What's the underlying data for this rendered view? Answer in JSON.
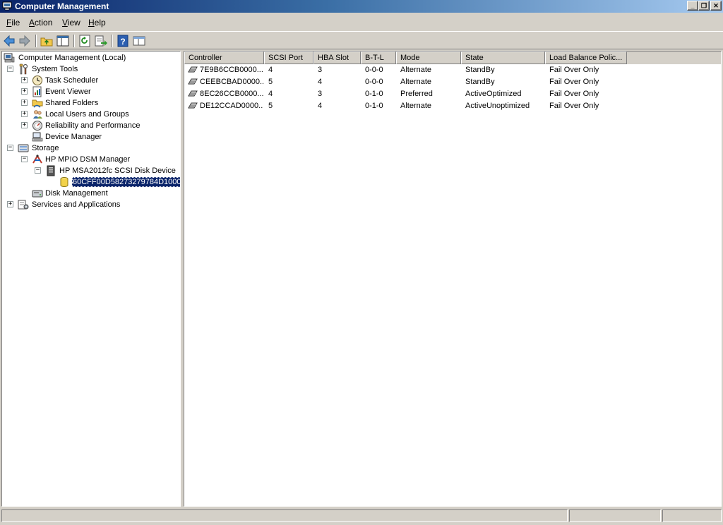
{
  "window": {
    "title": "Computer Management",
    "minimize": "_",
    "maximize": "❐",
    "close": "✕"
  },
  "menu": [
    "File",
    "Action",
    "View",
    "Help"
  ],
  "toolbar": [
    "back",
    "forward",
    "up-folder",
    "show-hide-tree",
    "refresh",
    "export-list",
    "help",
    "properties"
  ],
  "tree": {
    "root": "Computer Management (Local)",
    "system_tools": "System Tools",
    "task_scheduler": "Task Scheduler",
    "event_viewer": "Event Viewer",
    "shared_folders": "Shared Folders",
    "local_users": "Local Users and Groups",
    "reliability": "Reliability and Performance",
    "device_manager": "Device Manager",
    "storage": "Storage",
    "mpio": "HP MPIO DSM Manager",
    "msa_device": "HP MSA2012fc SCSI Disk Device",
    "disk_id": "60CFF00D58273279784D1000",
    "disk_management": "Disk Management",
    "services": "Services and Applications",
    "expand": "+",
    "collapse": "−"
  },
  "list": {
    "columns": [
      "Controller",
      "SCSI Port",
      "HBA Slot",
      "B-T-L",
      "Mode",
      "State",
      "Load Balance Polic..."
    ],
    "rows": [
      {
        "controller": "7E9B6CCB0000...",
        "scsi_port": "4",
        "hba_slot": "3",
        "btl": "0-0-0",
        "mode": "Alternate",
        "state": "StandBy",
        "policy": "Fail Over Only"
      },
      {
        "controller": "CEEBCBAD0000...",
        "scsi_port": "5",
        "hba_slot": "4",
        "btl": "0-0-0",
        "mode": "Alternate",
        "state": "StandBy",
        "policy": "Fail Over Only"
      },
      {
        "controller": "8EC26CCB0000...",
        "scsi_port": "4",
        "hba_slot": "3",
        "btl": "0-1-0",
        "mode": "Preferred",
        "state": "ActiveOptimized",
        "policy": "Fail Over Only"
      },
      {
        "controller": "DE12CCAD0000...",
        "scsi_port": "5",
        "hba_slot": "4",
        "btl": "0-1-0",
        "mode": "Alternate",
        "state": "ActiveUnoptimized",
        "policy": "Fail Over Only"
      }
    ]
  },
  "colors": {
    "selection": "#0a246a",
    "title_start": "#0a246a",
    "title_end": "#a6caf0",
    "chrome": "#d4d0c8"
  }
}
